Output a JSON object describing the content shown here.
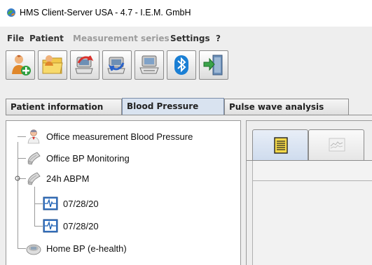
{
  "window": {
    "title": "HMS Client-Server USA - 4.7 - I.E.M. GmbH",
    "icon": "globe-leaf-icon"
  },
  "menu": [
    {
      "label": "File",
      "enabled": true
    },
    {
      "label": "Patient",
      "enabled": true
    },
    {
      "label": "Measurement series",
      "enabled": false
    },
    {
      "label": "Settings",
      "enabled": true
    },
    {
      "label": "?",
      "enabled": true
    }
  ],
  "toolbar": [
    {
      "icon": "new-patient-icon"
    },
    {
      "icon": "open-patient-folder-icon"
    },
    {
      "icon": "read-device-icon"
    },
    {
      "icon": "program-device-icon"
    },
    {
      "icon": "device-computer-icon"
    },
    {
      "icon": "bluetooth-icon"
    },
    {
      "icon": "exit-door-icon"
    }
  ],
  "tabs": [
    {
      "label": "Patient information",
      "active": false
    },
    {
      "label": "Blood Pressure",
      "active": true
    },
    {
      "label": "Pulse wave analysis",
      "active": false
    }
  ],
  "tree": [
    {
      "label": "Office measurement Blood Pressure",
      "icon": "doctor-icon",
      "level": 0
    },
    {
      "label": "Office BP Monitoring",
      "icon": "bp-monitor-icon",
      "level": 0
    },
    {
      "label": "24h ABPM",
      "icon": "bp-monitor-icon",
      "level": 0,
      "expanded": true
    },
    {
      "label": "07/28/20",
      "icon": "pulse-chart-icon",
      "level": 1
    },
    {
      "label": "07/28/20",
      "icon": "pulse-chart-icon",
      "level": 1
    },
    {
      "label": "Home BP (e-health)",
      "icon": "home-device-icon",
      "level": 0
    }
  ],
  "right_tabs": [
    {
      "icon": "notepad-icon",
      "active": true
    },
    {
      "icon": "chart-thumbnail-icon",
      "active": false
    }
  ],
  "colors": {
    "active_tab": "#d9e3f0",
    "selection": "#ffffff",
    "bluetooth": "#1a7fd4",
    "exit_green": "#3aa34a"
  }
}
